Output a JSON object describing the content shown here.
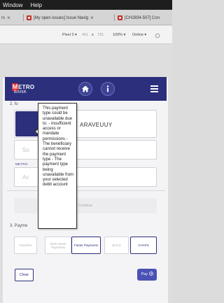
{
  "os_menu": {
    "items": [
      "Window",
      "Help"
    ]
  },
  "browser": {
    "tabs": [
      {
        "label": "rs"
      },
      {
        "label": "[My open issues] Issue Navig"
      },
      {
        "label": "[CH2834-507] Con"
      }
    ]
  },
  "devtools": {
    "device": "Pixel 2 ▾",
    "width": "411",
    "times": "x",
    "height": "731",
    "zoom": "100% ▾",
    "throttle": "Online ▾"
  },
  "header": {
    "logo_m": "M",
    "logo_etro": "ETRO",
    "logo_bank": "BANK",
    "home_icon": "home-icon",
    "info_icon": "info-icon",
    "menu_icon": "hamburger-menu-icon"
  },
  "form": {
    "section2_num": "2. fo",
    "account_name": "ARAVEUUY",
    "sort_placeholder": "So",
    "metro_label": "METRO",
    "account_placeholder": "Ac",
    "disabled_button": "Continue",
    "section3_label": "3. Payme",
    "payment_types": [
      {
        "label": "Transfers",
        "selected": false
      },
      {
        "label": "Metro Bank Payments",
        "selected": false
      },
      {
        "label": "Faster Payments",
        "selected": true
      },
      {
        "label": "BACS",
        "selected": false
      },
      {
        "label": "CHAPS",
        "selected": true
      }
    ],
    "clear_label": "Clear",
    "pay_label": "Pay"
  },
  "tooltip": {
    "lines": [
      "This payment",
      "type could be",
      "unavailable due",
      "to: - Insufficient",
      "access or",
      "mandate",
      "permissions -",
      "The beneficiary",
      "cannot receive",
      "the payment",
      "type - The",
      "payment type",
      "being",
      "unavailable from",
      "your selected",
      "debit account"
    ]
  },
  "colors": {
    "brand_navy": "#2b2f7c",
    "brand_red": "#d6262f",
    "pay_button": "#4a52b6"
  }
}
